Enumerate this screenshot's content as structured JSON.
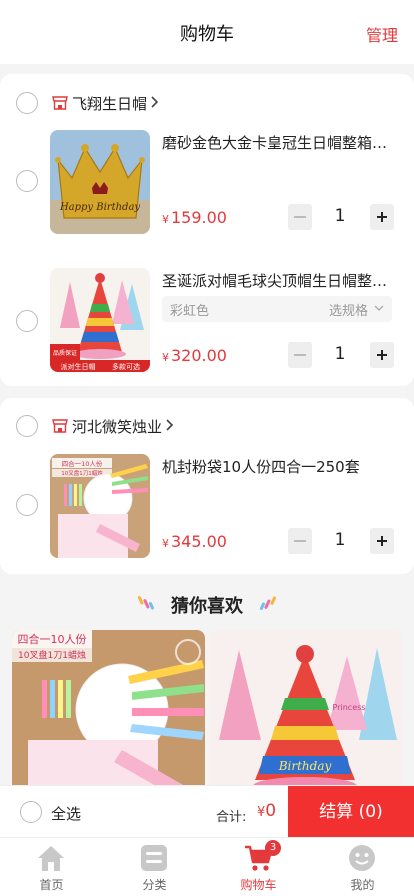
{
  "header": {
    "title": "购物车",
    "manage": "管理"
  },
  "shops": [
    {
      "name": "飞翔生日帽",
      "items": [
        {
          "title": "磨砂金色大金卡皇冠生日帽整箱批发",
          "spec": "",
          "price_symbol": "¥",
          "price": "159.00",
          "qty": "1"
        },
        {
          "title": "圣诞派对帽毛球尖顶帽生日帽整箱批发",
          "spec": "彩虹色",
          "spec_choose": "选规格",
          "price_symbol": "¥",
          "price": "320.00",
          "qty": "1"
        }
      ]
    },
    {
      "name": "河北微笑烛业",
      "items": [
        {
          "title": "机封粉袋10人份四合一250套",
          "spec": "",
          "price_symbol": "¥",
          "price": "345.00",
          "qty": "1"
        }
      ]
    }
  ],
  "thumb_texts": {
    "crown": "Happy Birthday",
    "hat_badge1": "派对生日帽",
    "hat_badge2": "多款可选",
    "hat_badge_top": "品质保证",
    "set_label1": "四合一10人份",
    "set_label2": "10叉盘1刀1蜡烛"
  },
  "guess": {
    "title": "猜你喜欢"
  },
  "recommend": [
    {
      "label1": "四合一10人份",
      "label2": "10叉盘1刀1蜡烛"
    },
    {
      "label1": "Birthday"
    }
  ],
  "bottom": {
    "select_all": "全选",
    "total_label": "合计:",
    "total_symbol": "¥",
    "total_value": "0",
    "checkout": "结算 (0)"
  },
  "tabs": [
    {
      "label": "首页",
      "icon": "home-icon"
    },
    {
      "label": "分类",
      "icon": "category-icon"
    },
    {
      "label": "购物车",
      "icon": "cart-icon",
      "badge": "3",
      "active": true
    },
    {
      "label": "我的",
      "icon": "profile-icon"
    }
  ],
  "colors": {
    "accent": "#e4393c",
    "checkout_bg": "#f23030",
    "page_bg": "#f4f4f4"
  }
}
